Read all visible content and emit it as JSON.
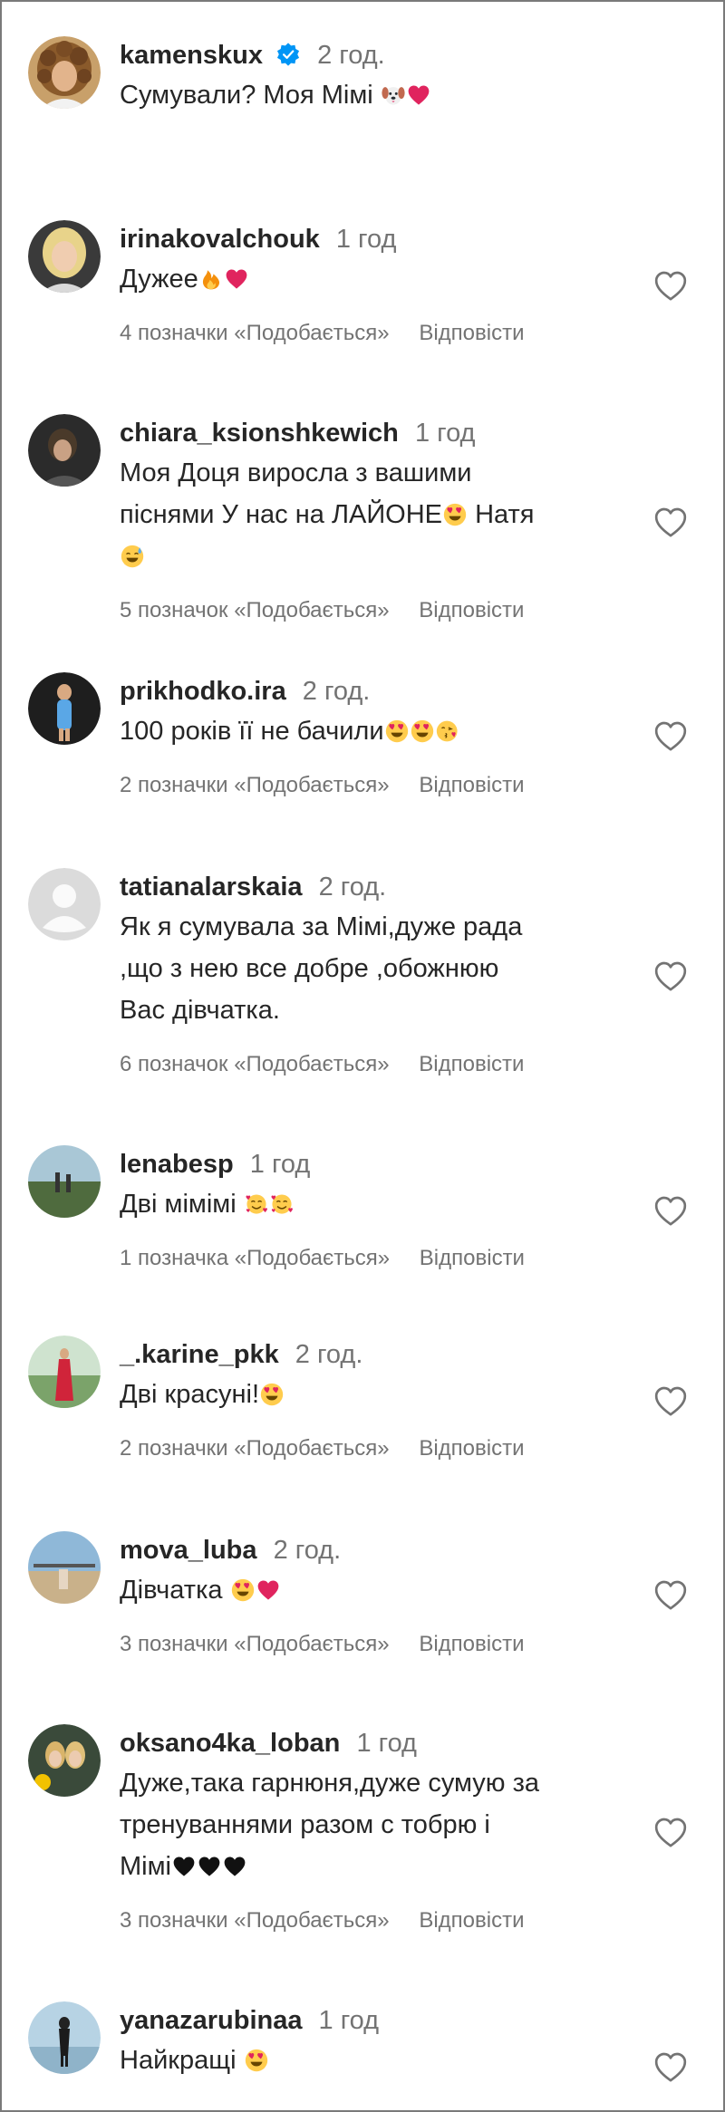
{
  "meta_labels": {
    "reply": "Відповісти"
  },
  "colors": {
    "text": "#262626",
    "secondary": "#737373",
    "verified": "#0095f6",
    "heart": "#e0245e"
  },
  "comments": [
    {
      "username": "kamenskux",
      "verified": true,
      "time": "2 год.",
      "text": "Сумували? Моя Мімі",
      "emoji": [
        "dog-face",
        "red-heart"
      ],
      "likes": "",
      "reply": ""
    },
    {
      "username": "irinakovalchouk",
      "verified": false,
      "time": "1 год",
      "text": "Дужее",
      "emoji": [
        "fire",
        "red-heart"
      ],
      "likes": "4 позначки «Подобається»",
      "reply": "Відповісти"
    },
    {
      "username": "chiara_ksionshkewich",
      "verified": false,
      "time": "1 год",
      "text_lines": [
        "Моя Доця виросла з вашими",
        "піснями У нас на ЛАЙОНЕ",
        "Натя",
        ""
      ],
      "likes": "5 позначок «Подобається»",
      "reply": "Відповісти"
    },
    {
      "username": "prikhodko.ira",
      "verified": false,
      "time": "2 год.",
      "text": "100 років її не бачили",
      "emoji": [
        "heart-eyes",
        "heart-eyes",
        "kissing-heart"
      ],
      "likes": "2 позначки «Подобається»",
      "reply": "Відповісти"
    },
    {
      "username": "tatianalarskaia",
      "verified": false,
      "time": "2 год.",
      "text_lines": [
        "Як я сумувала за Мімі,дуже рада",
        ",що з нею все добре ,обожнюю",
        "Вас дівчатка."
      ],
      "likes": "6 позначок «Подобається»",
      "reply": "Відповісти"
    },
    {
      "username": "lenabesp",
      "verified": false,
      "time": "1 год",
      "text": "Дві мімімі",
      "emoji": [
        "smiling-hearts",
        "smiling-hearts"
      ],
      "likes": "1 позначка «Подобається»",
      "reply": "Відповісти"
    },
    {
      "username": "_.karine_pkk",
      "verified": false,
      "time": "2 год.",
      "text": "Дві красуні!",
      "emoji": [
        "heart-eyes"
      ],
      "likes": "2 позначки «Подобається»",
      "reply": "Відповісти"
    },
    {
      "username": "mova_luba",
      "verified": false,
      "time": "2 год.",
      "text": "Дівчатка",
      "emoji": [
        "heart-eyes",
        "red-heart"
      ],
      "likes": "3 позначки «Подобається»",
      "reply": "Відповісти"
    },
    {
      "username": "oksano4ka_loban",
      "verified": false,
      "time": "1 год",
      "text_lines": [
        "Дуже,така гарнюня,дуже сумую за",
        "тренуваннями разом с тобрю і",
        "Мімі"
      ],
      "likes": "3 позначки «Подобається»",
      "reply": "Відповісти"
    },
    {
      "username": "yanazarubinaa",
      "verified": false,
      "time": "1 год",
      "text": "Найкращі",
      "emoji": [
        "heart-eyes"
      ],
      "likes": "",
      "reply": ""
    }
  ]
}
